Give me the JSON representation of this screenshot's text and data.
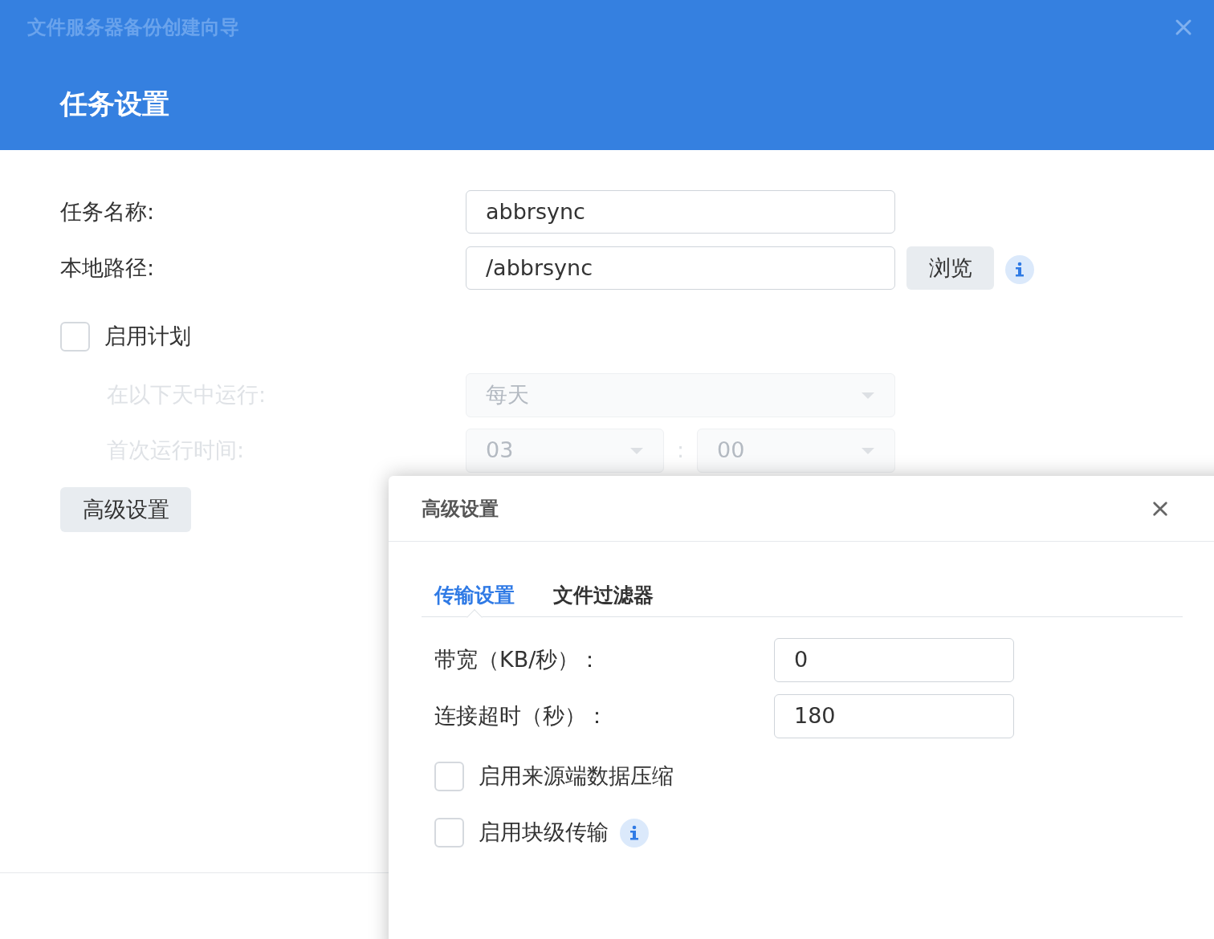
{
  "window": {
    "title": "文件服务器备份创建向导"
  },
  "header": {
    "title": "任务设置"
  },
  "fields": [
    {
      "label": "任务名称:",
      "value": "abbrsync",
      "info": false
    },
    {
      "label": "本地路径:",
      "value": "/abbrsync",
      "button": "浏览",
      "info": true
    }
  ],
  "schedule": {
    "label": "启用计划",
    "checked": false,
    "run_days": {
      "label": "在以下天中运行:",
      "value": "每天"
    },
    "first_run": {
      "label": "首次运行时间:",
      "hour": "03",
      "separator": ":",
      "minute": "00"
    }
  },
  "advanced_button": "高级设置",
  "dialog": {
    "title": "高级设置",
    "tabs": [
      {
        "label": "传输设置",
        "selected": true
      },
      {
        "label": "文件过滤器",
        "selected": false
      }
    ],
    "fields": [
      {
        "label": "带宽（KB/秒）：",
        "value": "0"
      },
      {
        "label": "连接超时（秒）：",
        "value": "180"
      }
    ],
    "options": [
      {
        "label": "启用来源端数据压缩",
        "checked": false,
        "info": false
      },
      {
        "label": "启用块级传输",
        "checked": false,
        "info": true
      }
    ]
  }
}
